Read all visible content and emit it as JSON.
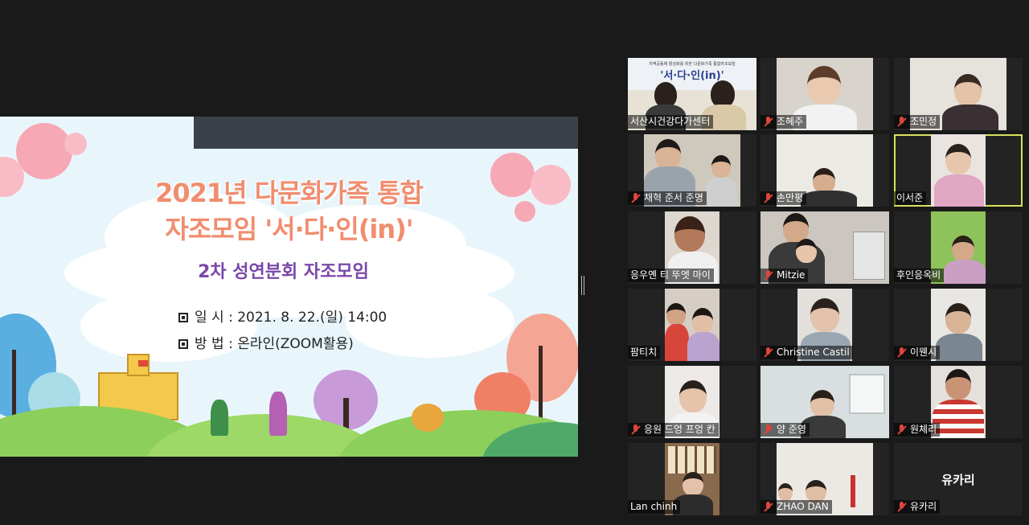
{
  "slide": {
    "title_line1": "2021년 다문화가족 통합",
    "title_line2": "자조모임 '서·다·인(in)'",
    "subtitle": "2차 성연분회 자조모임",
    "info1": "일  시 : 2021. 8. 22.(일) 14:00",
    "info2": "방  법 : 온라인(ZOOM활용)"
  },
  "participants": [
    {
      "name": "서산시건강다가센터",
      "muted": false,
      "banner_line1": "지역공동체 활성화를 위한 다문화가족 통합자조모임",
      "banner_line2": "'서·다·인(in)'"
    },
    {
      "name": "조혜주",
      "muted": true
    },
    {
      "name": "조민정",
      "muted": true
    },
    {
      "name": "채혁 준서 준명",
      "muted": true
    },
    {
      "name": "손만평",
      "muted": true
    },
    {
      "name": "이서준",
      "muted": false,
      "active": true
    },
    {
      "name": "응우옌 티 뚜엣 마이",
      "muted": false
    },
    {
      "name": "Mitzie",
      "muted": true
    },
    {
      "name": "후인응옥비",
      "muted": false
    },
    {
      "name": "팜티치",
      "muted": false
    },
    {
      "name": "Christine Castil",
      "muted": true
    },
    {
      "name": "이웬시",
      "muted": true
    },
    {
      "name": "응원 드엉 프엉 칸",
      "muted": true
    },
    {
      "name": "양 준영",
      "muted": true
    },
    {
      "name": "원체리",
      "muted": true
    },
    {
      "name": "Lan chinh",
      "muted": false
    },
    {
      "name": "ZHAO DAN",
      "muted": true
    },
    {
      "name": "유카리",
      "muted": true,
      "video_off": true,
      "display_name": "유카리"
    }
  ],
  "colors": {
    "active_border": "#d8e25a",
    "mic_muted": "#e0453d",
    "title_orange": "#f08d6f",
    "subtitle_purple": "#7a47a8"
  }
}
